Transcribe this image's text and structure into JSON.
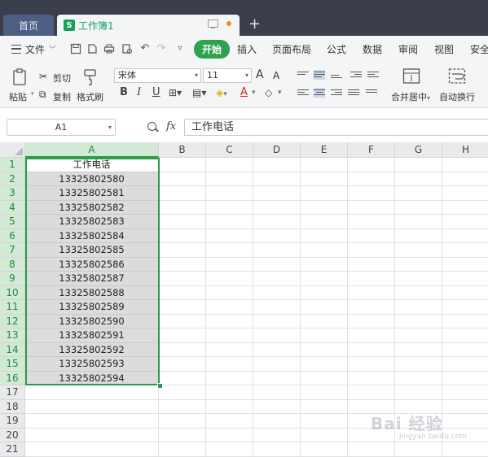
{
  "tabs": {
    "home": "首页",
    "doc_icon": "S",
    "doc": "工作簿1"
  },
  "menu": {
    "file": "文件",
    "start": "开始",
    "items": [
      "插入",
      "页面布局",
      "公式",
      "数据",
      "审阅",
      "视图",
      "安全"
    ]
  },
  "ribbon": {
    "paste": "粘贴",
    "cut": "剪切",
    "copy": "复制",
    "format_painter": "格式刷",
    "font": "宋体",
    "size": "11",
    "merge": "合并居中",
    "wrap": "自动换行",
    "grow": "A",
    "shrink": "A",
    "bold": "B",
    "italic": "I",
    "underline": "U",
    "font_color": "A"
  },
  "formula_bar": {
    "cell_ref": "A1",
    "fx": "fx",
    "content": "工作电话"
  },
  "grid": {
    "columns": [
      "A",
      "B",
      "C",
      "D",
      "E",
      "F",
      "G",
      "H"
    ],
    "rows": [
      "1",
      "2",
      "3",
      "4",
      "5",
      "6",
      "7",
      "8",
      "9",
      "10",
      "11",
      "12",
      "13",
      "14",
      "15",
      "16",
      "17",
      "18",
      "19",
      "20",
      "21"
    ],
    "column_a": [
      "工作电话",
      "13325802580",
      "13325802581",
      "13325802582",
      "13325802583",
      "13325802584",
      "13325802585",
      "13325802586",
      "13325802587",
      "13325802588",
      "13325802589",
      "13325802590",
      "13325802591",
      "13325802592",
      "13325802593",
      "13325802594"
    ]
  },
  "watermark": {
    "main": "Bai 经验",
    "sub": "jingyan.baidu.com"
  },
  "colors": {
    "accent": "#2ea24e",
    "selection": "#2a9d48",
    "titlebar": "#3a3f4b"
  }
}
